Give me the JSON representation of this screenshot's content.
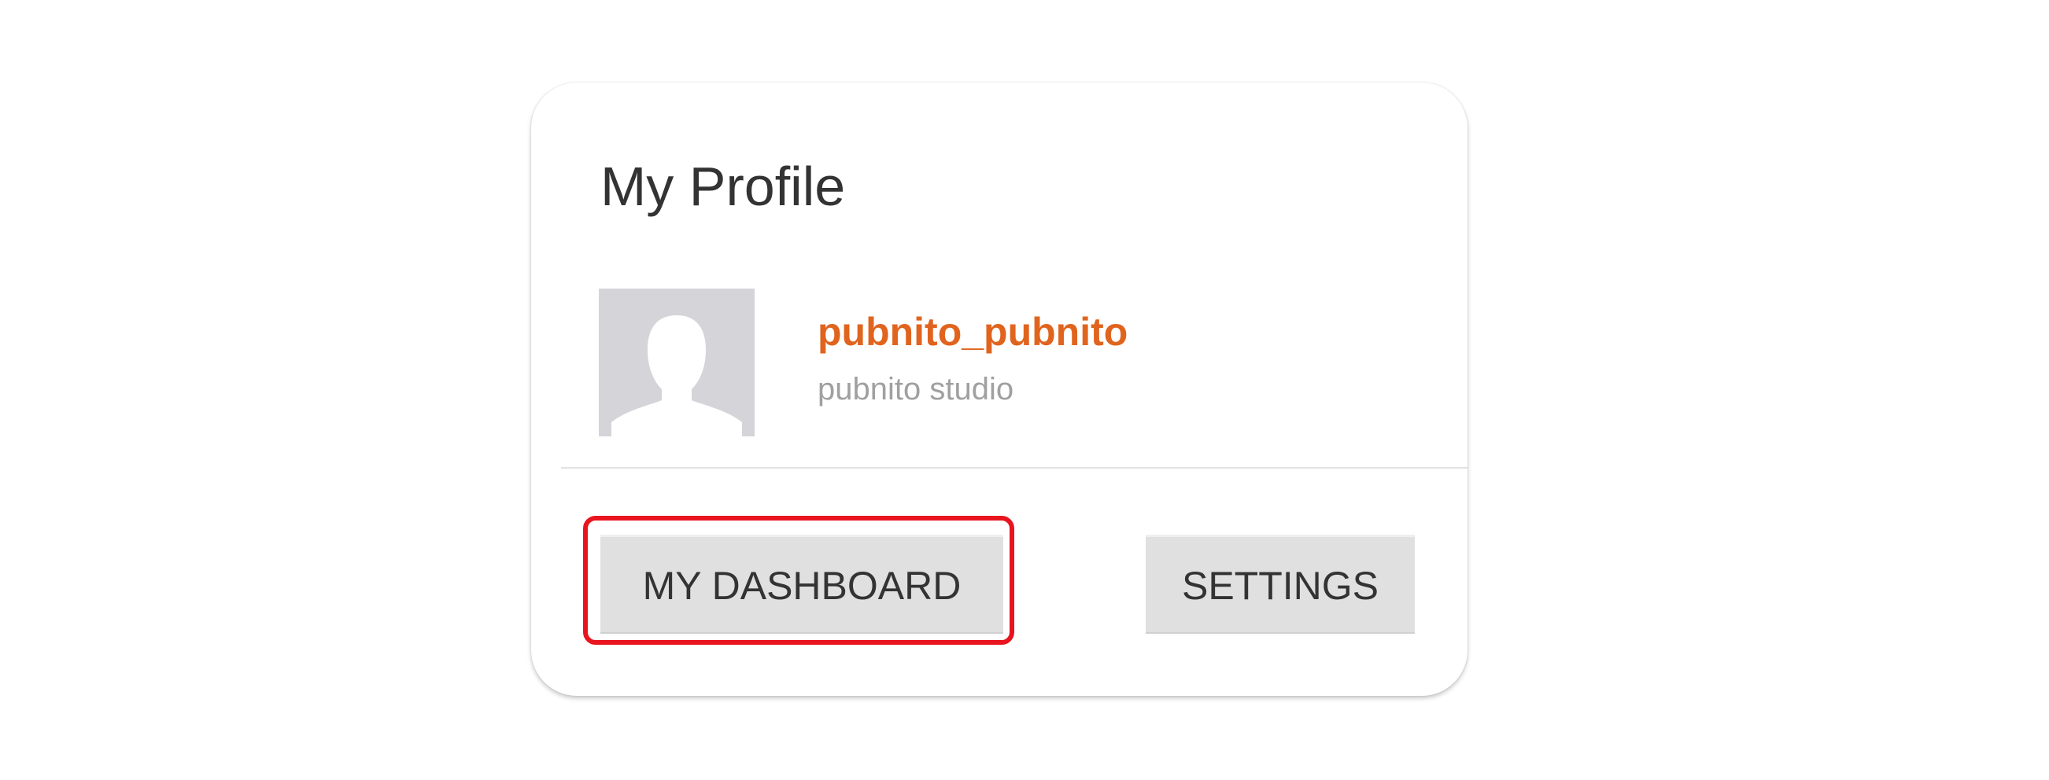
{
  "profile": {
    "title": "My Profile",
    "username": "pubnito_pubnito",
    "company": "pubnito studio",
    "avatar_icon": "user-silhouette-icon"
  },
  "actions": {
    "dashboard_label": "MY DASHBOARD",
    "settings_label": "SETTINGS"
  },
  "colors": {
    "username": "#e0641e",
    "highlight": "#e8141e",
    "button_bg": "#e0e0e0",
    "avatar_bg": "#d4d4d9"
  }
}
